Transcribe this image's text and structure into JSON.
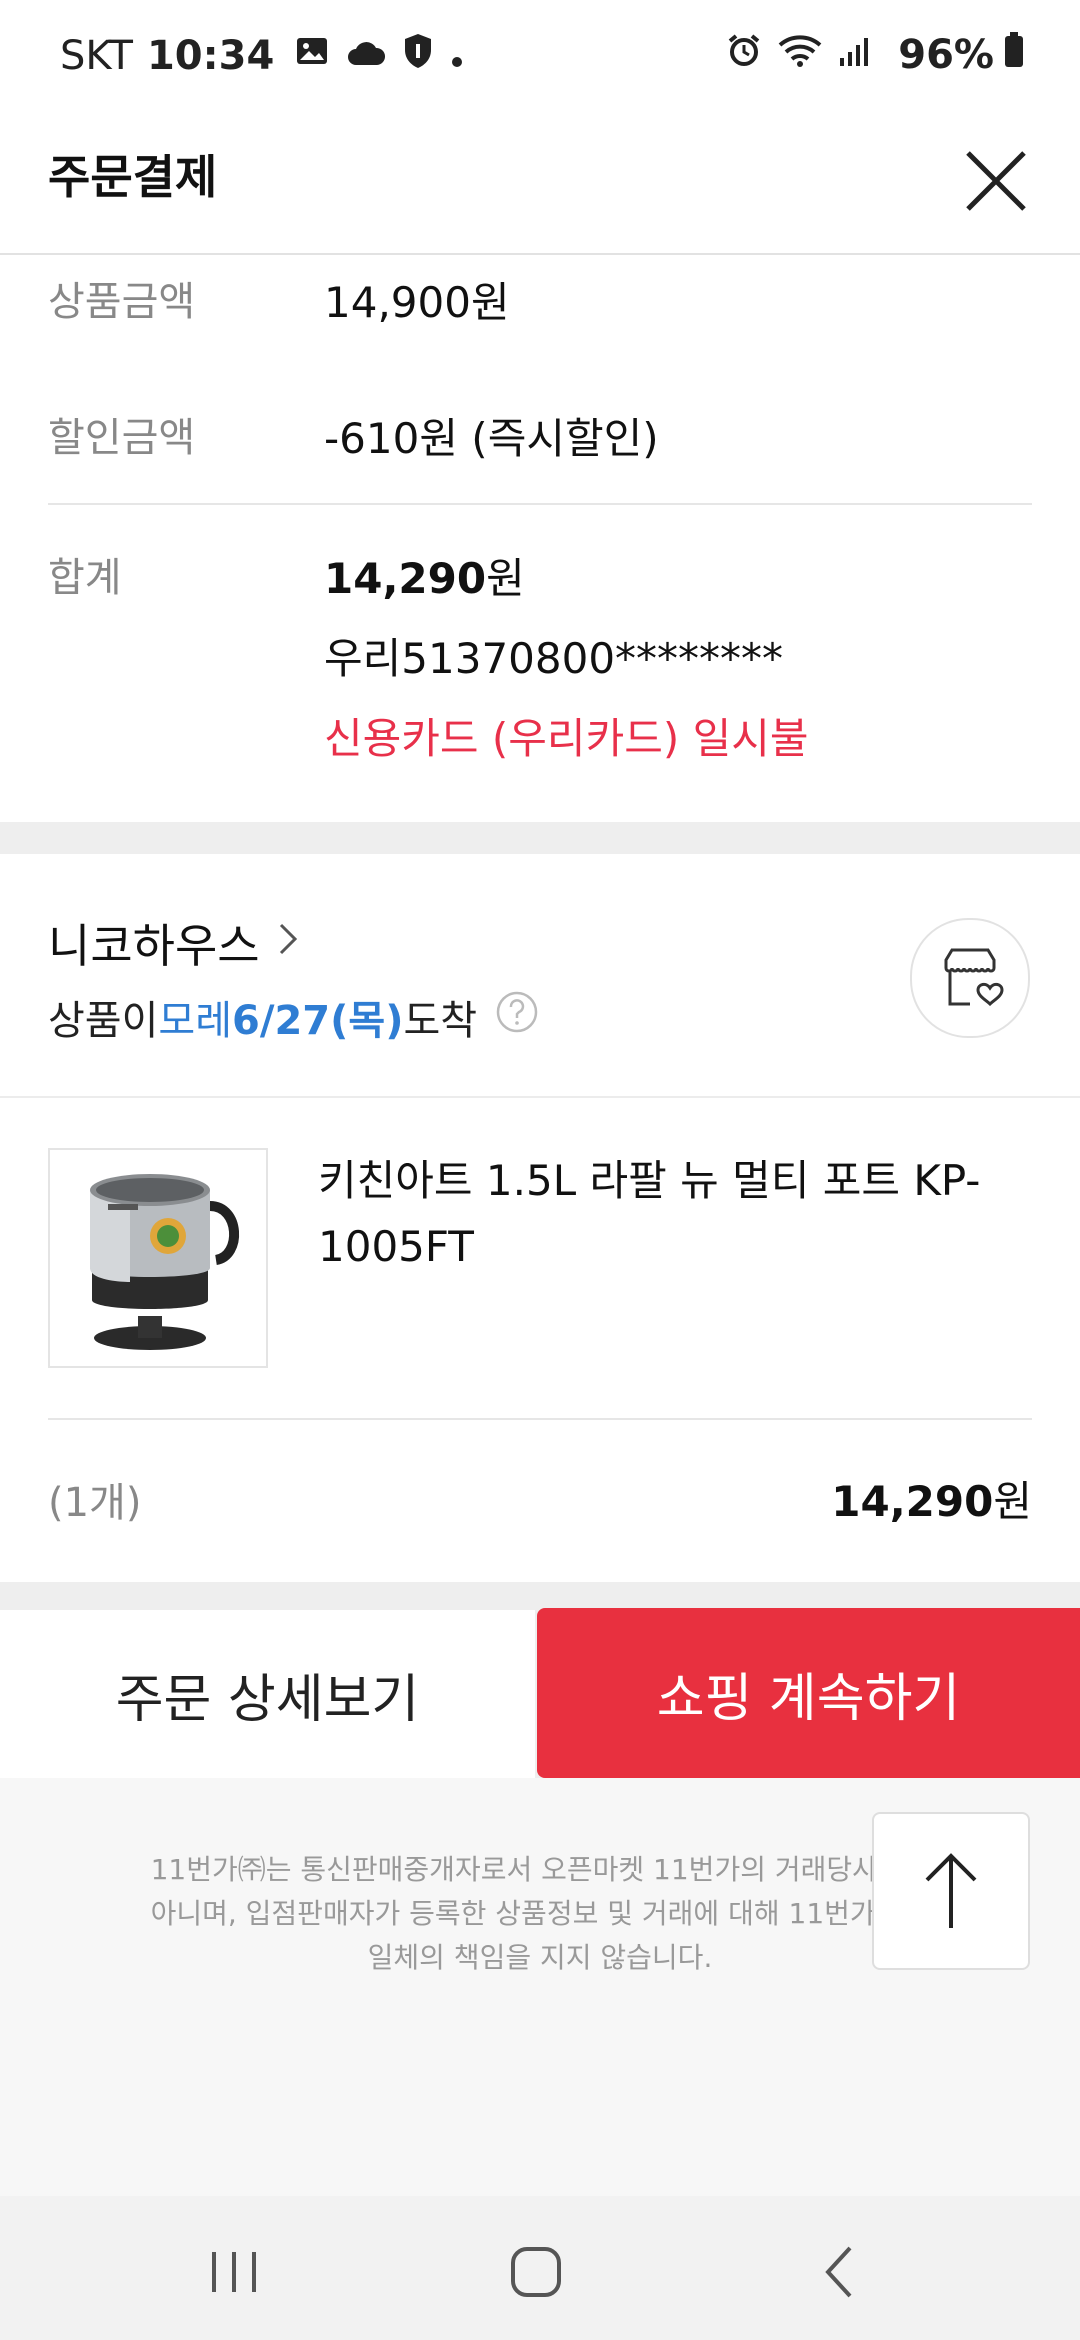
{
  "status_bar": {
    "carrier": "SKT",
    "time": "10:34",
    "battery": "96%"
  },
  "header": {
    "title": "주문결제"
  },
  "summary": {
    "product_amount_label": "상품금액",
    "product_amount_value": "14,900원",
    "discount_label": "할인금액",
    "discount_value": "-610원 (즉시할인)",
    "total_label": "합계",
    "total_number": "14,290",
    "total_unit": "원",
    "account": "우리51370800********",
    "card_type": "신용카드 (우리카드) 일시불"
  },
  "shop": {
    "name": "니코하우스",
    "delivery_prefix": "상품이 ",
    "delivery_day": "모레 ",
    "delivery_date": "6/27(목)",
    "delivery_suffix": " 도착"
  },
  "item": {
    "name": "키친아트 1.5L 라팔 뉴 멀티 포트 KP-1005FT",
    "quantity": "(1개)",
    "price_number": "14,290",
    "price_unit": "원"
  },
  "buttons": {
    "order_detail": "주문 상세보기",
    "continue_shopping": "쇼핑 계속하기"
  },
  "footer": {
    "notice_line1": "11번가㈜는 통신판매중개자로서 오픈마켓 11번가의 거래당사자가",
    "notice_line2": "아니며, 입점판매자가 등록한 상품정보 및 거래에 대해 11번가㈜는",
    "notice_line3": "일체의 책임을 지지 않습니다."
  },
  "colors": {
    "accent_red": "#e8303f",
    "delivery_blue": "#2f7dd3"
  }
}
